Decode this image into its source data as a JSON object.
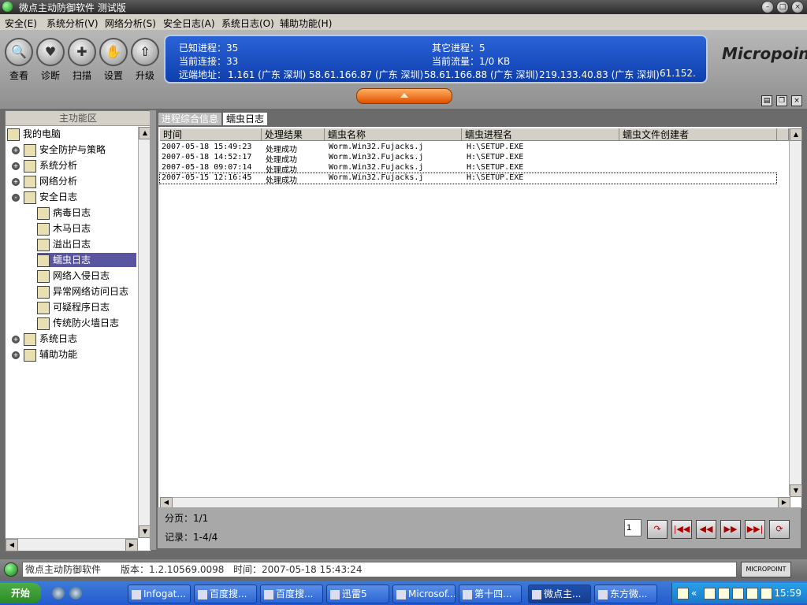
{
  "window": {
    "title": "微点主动防御软件  测试版"
  },
  "menu": [
    "安全(E)",
    "系统分析(V)",
    "网络分析(S)",
    "安全日志(A)",
    "系统日志(O)",
    "辅助功能(H)"
  ],
  "toolbar": [
    {
      "label": "查看",
      "icon": "magnifier-icon"
    },
    {
      "label": "诊断",
      "icon": "heart-icon"
    },
    {
      "label": "扫描",
      "icon": "scan-icon"
    },
    {
      "label": "设置",
      "icon": "hand-icon"
    },
    {
      "label": "升级",
      "icon": "upgrade-icon"
    }
  ],
  "info": {
    "known_processes": "已知进程：35",
    "other_processes": "其它进程：5",
    "connections": "当前连接：33",
    "traffic": "当前流量：1/0 KB",
    "remote_label": "远端地址：",
    "remote": [
      "1.161 (广东 深圳)",
      "58.61.166.87 (广东 深圳)",
      "58.61.166.88 (广东 深圳)",
      "219.133.40.83 (广东 深圳)",
      "61.152."
    ]
  },
  "brand": "Micropoint",
  "left_panel": {
    "header": "主功能区",
    "tree": [
      {
        "label": "我的电脑",
        "level": 0,
        "icon": "computer-icon",
        "expander": ""
      },
      {
        "label": "安全防护与策略",
        "level": 1,
        "icon": "shield-icon",
        "expander": "+"
      },
      {
        "label": "系统分析",
        "level": 1,
        "icon": "monitor-icon",
        "expander": "+"
      },
      {
        "label": "网络分析",
        "level": 1,
        "icon": "network-icon",
        "expander": "+"
      },
      {
        "label": "安全日志",
        "level": 1,
        "icon": "log-icon",
        "expander": "-"
      },
      {
        "label": "病毒日志",
        "level": 2,
        "icon": "virus-icon"
      },
      {
        "label": "木马日志",
        "level": 2,
        "icon": "trojan-icon"
      },
      {
        "label": "溢出日志",
        "level": 2,
        "icon": "overflow-icon"
      },
      {
        "label": "蠕虫日志",
        "level": 2,
        "icon": "worm-icon",
        "selected": true
      },
      {
        "label": "网络入侵日志",
        "level": 2,
        "icon": "sword-icon"
      },
      {
        "label": "异常网络访问日志",
        "level": 2,
        "icon": "netaccess-icon"
      },
      {
        "label": "可疑程序日志",
        "level": 2,
        "icon": "suspicious-icon"
      },
      {
        "label": "传统防火墙日志",
        "level": 2,
        "icon": "firewall-icon"
      },
      {
        "label": "系统日志",
        "level": 1,
        "icon": "syslog-icon",
        "expander": "+"
      },
      {
        "label": "辅助功能",
        "level": 1,
        "icon": "assist-icon",
        "expander": "+"
      }
    ]
  },
  "tabs": [
    "进程综合信息",
    "蠕虫日志"
  ],
  "table": {
    "columns": [
      "时间",
      "处理结果",
      "蠕虫名称",
      "蠕虫进程名",
      "蠕虫文件创建者"
    ],
    "rows": [
      [
        "2007-05-18 15:49:23",
        "处理成功",
        "Worm.Win32.Fujacks.j",
        "H:\\SETUP.EXE",
        ""
      ],
      [
        "2007-05-18 14:52:17",
        "处理成功",
        "Worm.Win32.Fujacks.j",
        "H:\\SETUP.EXE",
        ""
      ],
      [
        "2007-05-18 09:07:14",
        "处理成功",
        "Worm.Win32.Fujacks.j",
        "H:\\SETUP.EXE",
        ""
      ],
      [
        "2007-05-15 12:16:45",
        "处理成功",
        "Worm.Win32.Fujacks.j",
        "H:\\SETUP.EXE",
        ""
      ]
    ]
  },
  "pager": {
    "page": "分页：1/1",
    "records": "记录：1-4/4",
    "page_input": "1"
  },
  "statusbar": {
    "app": "微点主动防御软件",
    "version": "版本：1.2.10569.0098",
    "time": "时间：2007-05-18 15:43:24",
    "badge": "MICROPOINT"
  },
  "taskbar": {
    "start": "开始",
    "tasks": [
      "Infogat...",
      "百度搜...",
      "百度搜...",
      "迅雷5",
      "Microsof...",
      "第十四...",
      "微点主...",
      "东方微..."
    ],
    "active_task": 6,
    "clock": "15:59"
  }
}
